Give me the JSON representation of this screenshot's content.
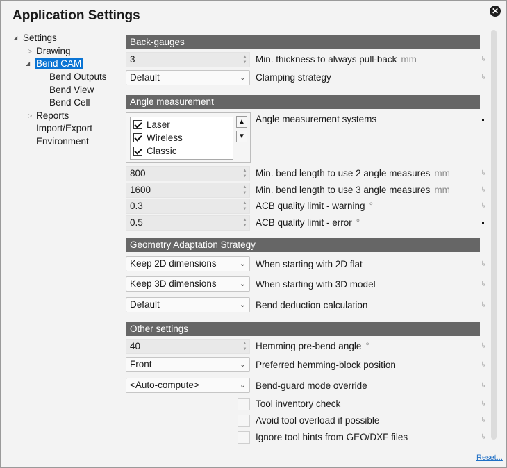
{
  "window": {
    "title": "Application Settings",
    "close_icon": "close-icon"
  },
  "tree": [
    {
      "label": "Settings",
      "expanded": true,
      "indent": 0,
      "arrow": "▲"
    },
    {
      "label": "Drawing",
      "expanded": false,
      "indent": 1,
      "arrow": "▷"
    },
    {
      "label": "Bend CAM",
      "expanded": true,
      "indent": 1,
      "arrow": "◢",
      "selected": true
    },
    {
      "label": "Bend Outputs",
      "indent": 2
    },
    {
      "label": "Bend View",
      "indent": 2
    },
    {
      "label": "Bend Cell",
      "indent": 2
    },
    {
      "label": "Reports",
      "expanded": false,
      "indent": 1,
      "arrow": "▷"
    },
    {
      "label": "Import/Export",
      "indent": 1
    },
    {
      "label": "Environment",
      "indent": 1
    }
  ],
  "sections": {
    "back_gauges": {
      "title": "Back-gauges",
      "min_thickness": {
        "value": "3",
        "label": "Min. thickness to always pull-back",
        "unit": "mm"
      },
      "clamping": {
        "value": "Default",
        "label": "Clamping strategy"
      }
    },
    "angle": {
      "title": "Angle measurement",
      "systems_label": "Angle measurement systems",
      "systems": [
        {
          "label": "Laser",
          "checked": true
        },
        {
          "label": "Wireless",
          "checked": true
        },
        {
          "label": "Classic",
          "checked": true
        }
      ],
      "min_len_2": {
        "value": "800",
        "label": "Min. bend length to use 2 angle measures",
        "unit": "mm"
      },
      "min_len_3": {
        "value": "1600",
        "label": "Min. bend length to use 3 angle measures",
        "unit": "mm"
      },
      "acb_warning": {
        "value": "0.3",
        "label": "ACB quality limit - warning",
        "unit": "°"
      },
      "acb_error": {
        "value": "0.5",
        "label": "ACB quality limit - error",
        "unit": "°"
      }
    },
    "geometry": {
      "title": "Geometry Adaptation Strategy",
      "flat_2d": {
        "value": "Keep 2D dimensions",
        "label": "When starting with 2D flat"
      },
      "model_3d": {
        "value": "Keep 3D dimensions",
        "label": "When starting with 3D model"
      },
      "deduction": {
        "value": "Default",
        "label": "Bend deduction calculation"
      }
    },
    "other": {
      "title": "Other settings",
      "hemming_angle": {
        "value": "40",
        "label": "Hemming pre-bend angle",
        "unit": "°"
      },
      "hemming_block": {
        "value": "Front",
        "label": "Preferred hemming-block position"
      },
      "bend_guard": {
        "value": "<Auto-compute>",
        "label": "Bend-guard mode override"
      },
      "tool_inventory": {
        "label": "Tool inventory check",
        "checked": false
      },
      "avoid_overload": {
        "label": "Avoid tool overload if possible",
        "checked": false
      },
      "ignore_hints": {
        "label": "Ignore tool hints from GEO/DXF files",
        "checked": false
      }
    }
  },
  "footer": {
    "reset_label": "Reset..."
  },
  "colors": {
    "section_header": "#666666",
    "selection": "#0a74d4",
    "link": "#1f6fc5"
  }
}
